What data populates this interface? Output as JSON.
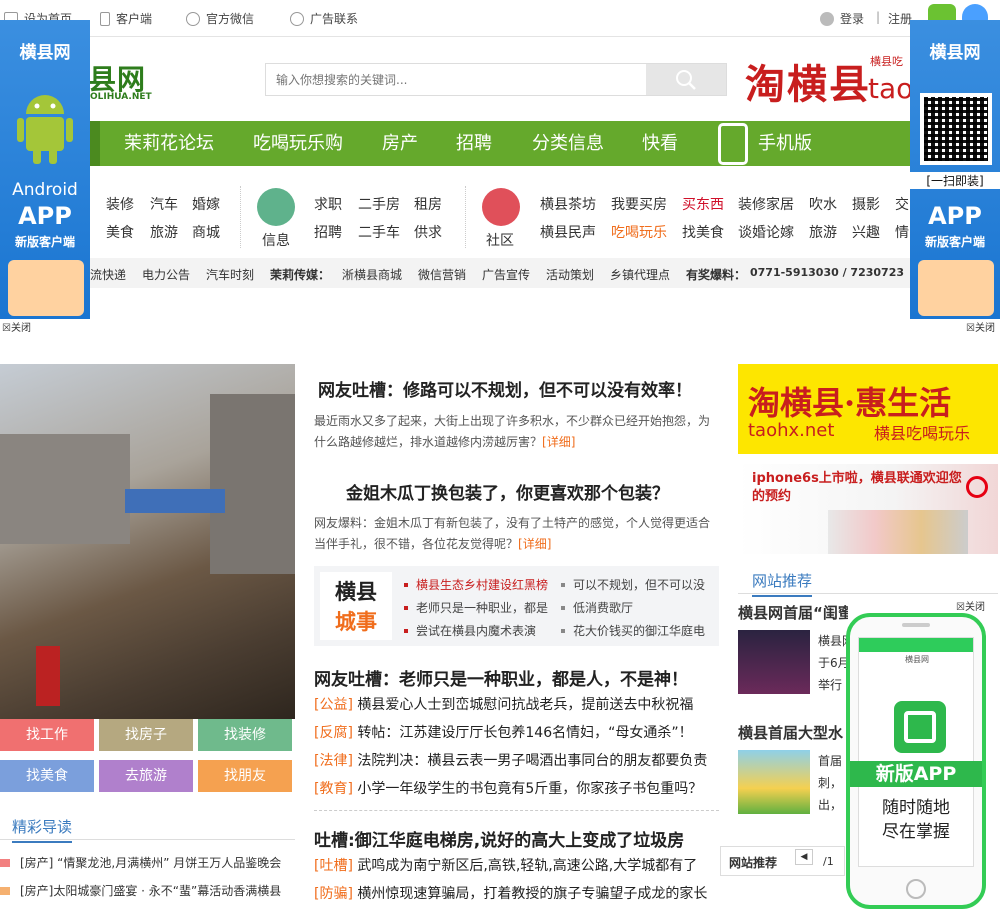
{
  "topbar": {
    "home": "设为首页",
    "client": "客户端",
    "wechat": "官方微信",
    "ads": "广告联系",
    "login": "登录",
    "sep": "|",
    "register": "注册"
  },
  "logo": {
    "text": "县网",
    "sub": "OLIHUA.NET"
  },
  "search": {
    "placeholder": "输入你想搜索的关键词..."
  },
  "taoban": {
    "title": "淘横县",
    "side": "横县吃",
    "hx": "tao"
  },
  "nav": {
    "items": [
      "茉莉花论坛",
      "吃喝玩乐购",
      "房产",
      "招聘",
      "分类信息",
      "快看",
      "手机版"
    ]
  },
  "cats": {
    "group1": [
      "装修",
      "汽车",
      "婚嫁",
      "美食",
      "旅游",
      "商城"
    ],
    "group2_label": "信息",
    "group2": [
      "求职",
      "二手房",
      "租房",
      "招聘",
      "二手车",
      "供求"
    ],
    "group3_label": "社区",
    "group3": [
      "横县茶坊",
      "我要买房",
      "买东西",
      "装修家居",
      "吹水",
      "摄影",
      "交",
      "横县民声",
      "吃喝玩乐",
      "找美食",
      "谈婚论嫁",
      "旅游",
      "兴趣",
      "情"
    ]
  },
  "subbar": {
    "items": [
      "流快递",
      "电力公告",
      "汽车时刻",
      "茉莉传媒：",
      "淅横县商城",
      "微信营销",
      "广告宣传",
      "活动策划",
      "乡镇代理点",
      "有奖爆料：",
      "0771-5913030 / 7230723"
    ]
  },
  "sidead": {
    "left": {
      "title": "横县网",
      "os": "Android",
      "app": "APP",
      "sub": "新版客户端",
      "close": "关闭"
    },
    "right": {
      "title": "横县网",
      "scan": "[一扫即装]",
      "app": "APP",
      "sub": "新版客户端",
      "close": "关闭"
    }
  },
  "quick": [
    "找工作",
    "找房子",
    "找装修",
    "找美食",
    "去旅游",
    "找朋友"
  ],
  "featured": {
    "title": "精彩导读",
    "rows": [
      "[房产] “情聚龙池,月满横州” 月饼王万人品鉴晚会",
      "[房产]太阳城豪门盛宴 · 永不“蜚”幕活动香满横县"
    ]
  },
  "main": {
    "h1": "网友吐槽：修路可以不规划，但不可以没有效率！",
    "s1": "最近雨水又多了起来，大街上出现了许多积水，不少群众已经开始抱怨，为什么路越修越烂，排水道越修内涝越厉害？",
    "d1": "[详细]",
    "h2": "金姐木瓜丁换包装了，你更喜欢那个包装？",
    "s2": "网友爆料：金姐木瓜丁有新包装了，没有了土特产的感觉，个人觉得更适合当伴手礼，很不错，各位花友觉得呢？",
    "d2": "[详细]",
    "city": {
      "logo1": "横县",
      "logo2": "城事",
      "items": [
        "横县生态乡村建设红黑榜",
        "可以不规划，但不可以没",
        "老师只是一种职业，都是",
        "低消费歌厅",
        "尝试在横县内魔术表演",
        "花大价钱买的御江华庭电"
      ]
    },
    "h3": "网友吐槽：老师只是一种职业，都是人，不是神！",
    "news1": [
      {
        "tag": "[公益]",
        "text": "横县爱心人士到峦城慰问抗战老兵，提前送去中秋祝福"
      },
      {
        "tag": "[反腐]",
        "text": "转帖：江苏建设厅厅长包养146名情妇，“母女通杀”！"
      },
      {
        "tag": "[法律]",
        "text": "法院判决：横县云表一男子喝酒出事同台的朋友都要负责"
      },
      {
        "tag": "[教育]",
        "text": "小学一年级学生的书包竟有5斤重，你家孩子书包重吗？"
      }
    ],
    "h4": "吐槽:御江华庭电梯房,说好的高大上变成了垃圾房",
    "news2": [
      {
        "tag": "[吐槽]",
        "text": "武鸣成为南宁新区后,高铁,轻轨,高速公路,大学城都有了"
      },
      {
        "tag": "[防骗]",
        "text": "横州惊现速算骗局，打着教授的旗子专骗望子成龙的家长"
      }
    ]
  },
  "right": {
    "ad1_title": "淘横县·惠生活",
    "ad1_url": "taohx.net",
    "ad1_slogan": "横县吃喝玩乐",
    "ad2_text": "iphone6s上市啦，横县联通欢迎您的预约",
    "rec_title": "网站推荐",
    "rec_close": "关闭",
    "rec1_title": "横县网首届“闺蜜秀”颁奖典",
    "rec1_text": "横县网\n于6月\n举行",
    "rec2_title": "横县首届大型水",
    "rec2_text": "首届\n刺，\n出，"
  },
  "phone_float": {
    "badge": "新版APP",
    "line1": "随时随地",
    "line2": "尽在掌握",
    "appname": "横县网"
  },
  "ticker": {
    "label": "网站推荐",
    "page": "/1"
  },
  "colors": {
    "green": "#65a92c",
    "red": "#c81e1e",
    "orange": "#f06d1c",
    "blue": "#3b7bbf"
  }
}
